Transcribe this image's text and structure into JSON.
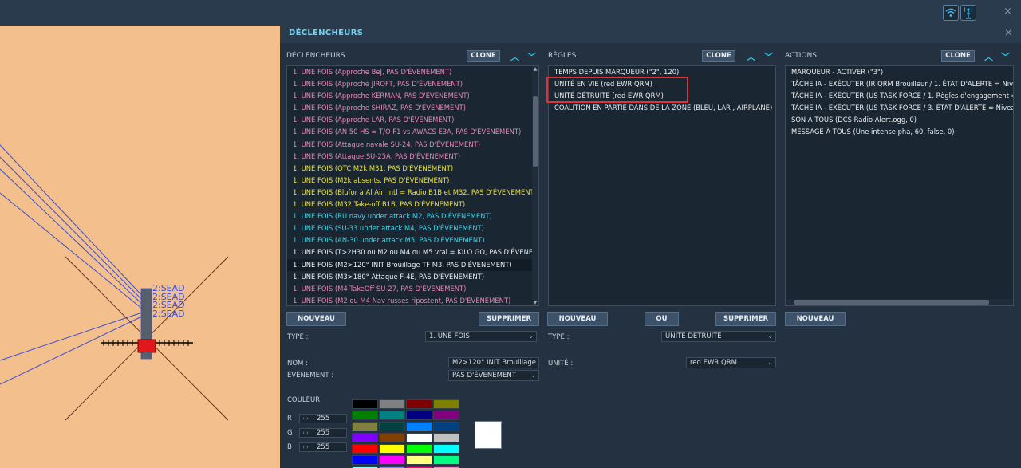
{
  "top_icons": [
    "wifi-icon",
    "signal-tower-icon"
  ],
  "close_symbol": "×",
  "map": {
    "labels": [
      "2:SEAD",
      "2:SEAD",
      "2:SEAD",
      "2:SEAD"
    ],
    "colors": {
      "ground": "#f3bf8c",
      "route": "#3b4fd1",
      "marker": "#e0171c"
    }
  },
  "panel": {
    "title": "DÉCLENCHEURS"
  },
  "triggers": {
    "title": "DÉCLENCHEURS",
    "clone_label": "CLONE",
    "items": [
      {
        "text": "1. UNE FOIS (Approche BeJ, PAS D'ÉVENEMENT)",
        "color": "#e487b8"
      },
      {
        "text": "1. UNE FOIS (Approche JIROFT, PAS D'ÉVENEMENT)",
        "color": "#e487b8"
      },
      {
        "text": "1. UNE FOIS (Approche KERMAN, PAS D'ÉVENEMENT)",
        "color": "#e487b8"
      },
      {
        "text": "1. UNE FOIS (Approche SHIRAZ, PAS D'ÉVENEMENT)",
        "color": "#e487b8"
      },
      {
        "text": "1. UNE FOIS (Approche LAR, PAS D'ÉVENEMENT)",
        "color": "#e487b8"
      },
      {
        "text": "1. UNE FOIS (AN 50 HS = T/O F1 vs AWACS E3A, PAS D'ÉVENEMENT)",
        "color": "#e487b8"
      },
      {
        "text": "1. UNE FOIS (Attaque navale SU-24, PAS D'ÉVENEMENT)",
        "color": "#e487b8"
      },
      {
        "text": "1. UNE FOIS (Attaque SU-25A, PAS D'ÉVENEMENT)",
        "color": "#e487b8"
      },
      {
        "text": "1. UNE FOIS (QTC M2k M31, PAS D'ÉVENEMENT)",
        "color": "#e8e23a"
      },
      {
        "text": "1. UNE FOIS (M2k absents, PAS D'ÉVENEMENT)",
        "color": "#e8e23a"
      },
      {
        "text": "1. UNE FOIS (Blufor à Al Ain Intl = Radio B1B et M32, PAS D'ÉVENEMENT)",
        "color": "#e8e23a"
      },
      {
        "text": "1. UNE FOIS (M32 Take-off B1B, PAS D'ÉVENEMENT)",
        "color": "#e8e23a"
      },
      {
        "text": "1. UNE FOIS (RU navy under attack M2, PAS D'ÉVENEMENT)",
        "color": "#3fd8e8"
      },
      {
        "text": "1. UNE FOIS (SU-33 under attack M4, PAS D'ÉVENEMENT)",
        "color": "#3fd8e8"
      },
      {
        "text": "1. UNE FOIS (AN-30 under attack M5, PAS D'ÉVENEMENT)",
        "color": "#3fd8e8"
      },
      {
        "text": "1. UNE FOIS (T>2H30 ou M2 ou M4 ou M5 vrai = KILO GO, PAS D'ÉVENEMENT)",
        "color": "#e9eef2"
      },
      {
        "text": "1. UNE FOIS (M2>120° INIT Brouillage TF M3, PAS D'ÉVENEMENT)",
        "color": "#e9eef2",
        "selected": true
      },
      {
        "text": "1. UNE FOIS (M3>180° Attaque F-4E, PAS D'ÉVENEMENT)",
        "color": "#e9eef2"
      },
      {
        "text": "1. UNE FOIS (M4 TakeOff SU-27, PAS D'ÉVENEMENT)",
        "color": "#e487b8"
      },
      {
        "text": "1. UNE FOIS (M2 ou M4 Nav russes ripostent, PAS D'ÉVENEMENT)",
        "color": "#e487b8"
      }
    ],
    "nouveau_label": "NOUVEAU",
    "supprimer_label": "SUPPRIMER",
    "type_label": "TYPE :",
    "type_value": "1. UNE FOIS",
    "nom_label": "NOM :",
    "nom_value": "M2>120° INIT Brouillage T",
    "evenement_label": "ÉVÈNEMENT :",
    "evenement_value": "PAS D'ÉVENEMENT",
    "couleur_label": "COULEUR",
    "rgb": [
      {
        "label": "R",
        "value": "255"
      },
      {
        "label": "G",
        "value": "255"
      },
      {
        "label": "B",
        "value": "255"
      }
    ],
    "palette": [
      "#000000",
      "#808080",
      "#800000",
      "#808000",
      "#008000",
      "#008080",
      "#000080",
      "#800080",
      "#808040",
      "#004040",
      "#0080ff",
      "#004080",
      "#8000ff",
      "#804000",
      "#ffffff",
      "#c0c0c0",
      "#ff0000",
      "#ffff00",
      "#00ff00",
      "#00ffff",
      "#0000ff",
      "#ff00ff",
      "#ffff80",
      "#00ff80",
      "#80ffff",
      "#8080ff",
      "#ff0080",
      "#ff80c0"
    ],
    "preview_color": "#ffffff"
  },
  "rules": {
    "title": "RÈGLES",
    "clone_label": "CLONE",
    "items": [
      "TEMPS DEPUIS MARQUEUR (\"2\", 120)",
      "UNITÉ EN VIE (red EWR QRM)",
      "UNITÉ DÉTRUITE (red EWR QRM)",
      "COALITION EN PARTIE DANS DE LA ZONE (BLEU, LAR , AIRPLANE)"
    ],
    "highlight_color": "#e0303a",
    "nouveau_label": "NOUVEAU",
    "ou_label": "OU",
    "supprimer_label": "SUPPRIMER",
    "type_label": "TYPE :",
    "type_value": "UNITÉ DÉTRUITE",
    "unite_label": "UNITÉ :",
    "unite_value": "red EWR QRM"
  },
  "actions": {
    "title": "ACTIONS",
    "clone_label": "CLONE",
    "items": [
      "MARQUEUR - ACTIVER (\"3\")",
      "TÂCHE IA - EXÉCUTER (IR QRM Brouilleur / 1. ÉTAT D'ALERTE = Niveau RO",
      "TÂCHE IA - EXÉCUTER (US TASK FORCE / 1. Règles d'engagement = TIR INT",
      "TÂCHE IA - EXÉCUTER (US TASK FORCE / 3. ÉTAT D'ALERTE = Niveau VERT",
      "SON À TOUS (DCS Radio Alert.ogg, 0)",
      "MESSAGE À TOUS (Une intense pha, 60, false, 0)"
    ],
    "nouveau_label": "NOUVEAU"
  }
}
